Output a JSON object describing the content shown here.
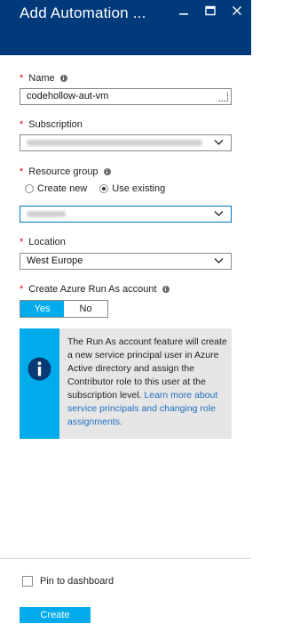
{
  "header": {
    "title": "Add Automation ...",
    "minimize_icon": "minimize-icon",
    "maximize_icon": "maximize-icon",
    "close_icon": "close-icon",
    "background": "#003a7b"
  },
  "form": {
    "name": {
      "label": "Name",
      "value": "codehollow-aut-vm"
    },
    "subscription": {
      "label": "Subscription"
    },
    "resource_group": {
      "label": "Resource group",
      "options": [
        "Create new",
        "Use existing"
      ],
      "selected": "Use existing"
    },
    "location": {
      "label": "Location",
      "value": "West Europe"
    },
    "run_as": {
      "label": "Create Azure Run As account",
      "yes": "Yes",
      "no": "No",
      "selected": "Yes"
    },
    "required_marker": "*"
  },
  "info": {
    "text": "The Run As account feature will create a new service principal user in Azure Active directory and assign the Contributor role to this user at the subscription level.",
    "link": "Learn more about service principals and changing role assignments.",
    "icon": "info-icon"
  },
  "footer": {
    "pin_label": "Pin to dashboard",
    "pin_checked": false,
    "create_label": "Create"
  },
  "colors": {
    "accent": "#00abec",
    "link": "#1e6fc4",
    "required": "#e0001b",
    "focus_border": "#0072c6"
  }
}
